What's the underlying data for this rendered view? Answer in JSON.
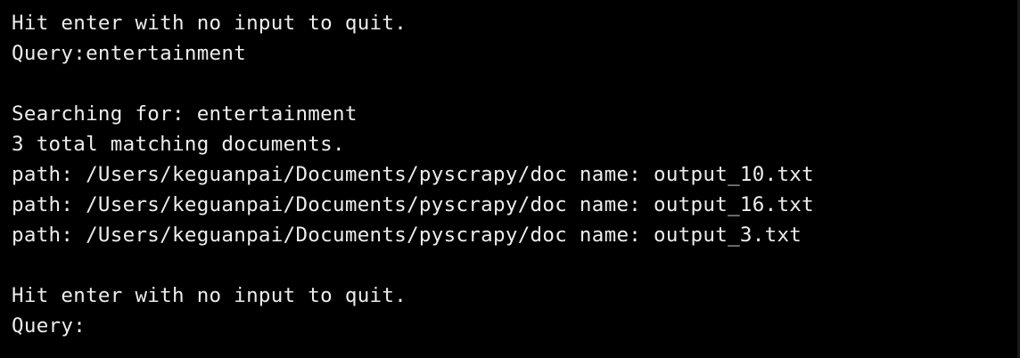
{
  "terminal": {
    "lines": [
      "Hit enter with no input to quit.",
      "Query:entertainment",
      "",
      "Searching for: entertainment",
      "3 total matching documents.",
      "path: /Users/keguanpai/Documents/pyscrapy/doc name: output_10.txt",
      "path: /Users/keguanpai/Documents/pyscrapy/doc name: output_16.txt",
      "path: /Users/keguanpai/Documents/pyscrapy/doc name: output_3.txt",
      "",
      "Hit enter with no input to quit.",
      "Query:"
    ],
    "colors": {
      "background": "#000000",
      "text": "#ededed"
    }
  }
}
